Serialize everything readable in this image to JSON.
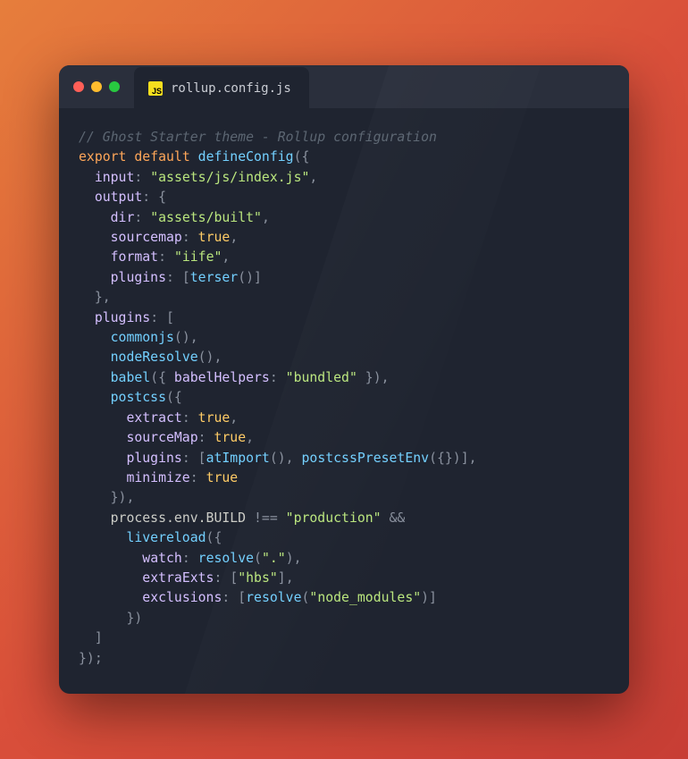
{
  "tab": {
    "filename": "rollup.config.js",
    "badge": "JS"
  },
  "traffic": {
    "close": "red",
    "min": "yellow",
    "max": "green"
  },
  "code": {
    "comment": "// Ghost Starter theme - Rollup configuration",
    "kw_export": "export",
    "kw_default": "default",
    "fn_defineConfig": "defineConfig",
    "p_input": "input",
    "v_input": "\"assets/js/index.js\"",
    "p_output": "output",
    "p_dir": "dir",
    "v_dir": "\"assets/built\"",
    "p_sourcemap": "sourcemap",
    "v_true": "true",
    "p_format": "format",
    "v_format": "\"iife\"",
    "p_plugins": "plugins",
    "fn_terser": "terser",
    "fn_commonjs": "commonjs",
    "fn_nodeResolve": "nodeResolve",
    "fn_babel": "babel",
    "p_babelHelpers": "babelHelpers",
    "v_bundled": "\"bundled\"",
    "fn_postcss": "postcss",
    "p_extract": "extract",
    "p_sourceMap": "sourceMap",
    "fn_atImport": "atImport",
    "fn_postcssPresetEnv": "postcssPresetEnv",
    "p_minimize": "minimize",
    "expr_processEnvBuild": "process.env.BUILD",
    "v_production": "\"production\"",
    "fn_livereload": "livereload",
    "p_watch": "watch",
    "fn_resolve": "resolve",
    "v_dot": "\".\"",
    "p_extraExts": "extraExts",
    "v_hbs": "\"hbs\"",
    "p_exclusions": "exclusions",
    "v_nodeModules": "\"node_modules\"",
    "op_neq": "!==",
    "op_and": "&&"
  }
}
